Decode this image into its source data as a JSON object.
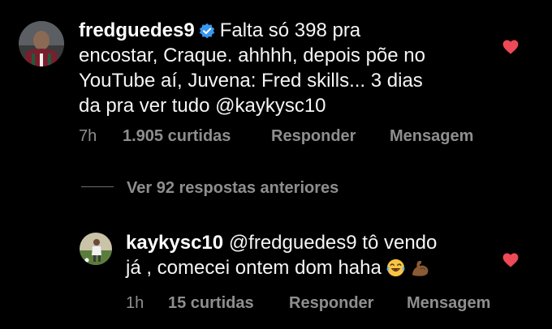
{
  "comment": {
    "username": "fredguedes9",
    "verified_icon": "verified-badge-icon",
    "text_lines": [
      "Falta só 398 pra",
      "encostar, Craque. ahhhh, depois põe no",
      "YouTube aí, Juvena: Fred skills... 3 dias",
      "da pra ver tudo @kaykysc10"
    ],
    "time": "7h",
    "likes": "1.905 curtidas",
    "reply_label": "Responder",
    "message_label": "Mensagem"
  },
  "view_replies": {
    "label": "Ver 92 respostas anteriores"
  },
  "reply": {
    "username": "kaykysc10",
    "text_lines": [
      "@fredguedes9 tô vendo",
      "já , comecei ontem dom haha"
    ],
    "emojis": [
      "laughing-tears-icon",
      "flexed-biceps-icon"
    ],
    "time": "1h",
    "likes": "15 curtidas",
    "reply_label": "Responder",
    "message_label": "Mensagem"
  },
  "colors": {
    "background": "#000000",
    "text": "#f5f5f5",
    "secondary": "#8e8e8e",
    "like_heart": "#ed4956",
    "verified": "#3897f0"
  }
}
